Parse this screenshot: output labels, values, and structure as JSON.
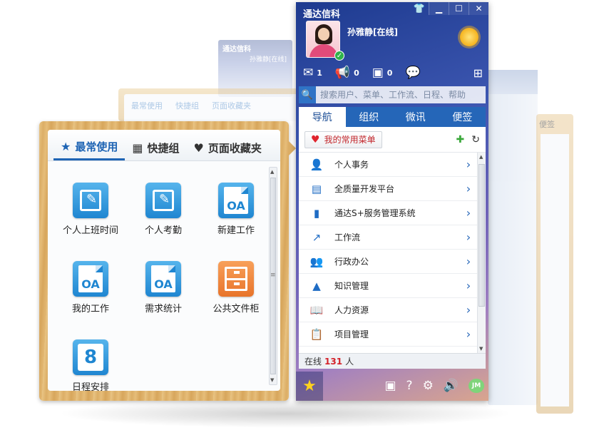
{
  "ghost": {
    "title": "通达信科",
    "name": "孙雅静[在线]",
    "tabs": [
      "最常使用",
      "快捷组",
      "页面收藏夹"
    ],
    "right_label": "便签"
  },
  "favorites": {
    "tabs": [
      {
        "label": "最常使用",
        "icon": "star-icon",
        "active": true
      },
      {
        "label": "快捷组",
        "icon": "grid-icon",
        "active": false
      },
      {
        "label": "页面收藏夹",
        "icon": "heart-icon",
        "active": false
      }
    ],
    "apps": [
      {
        "label": "个人上班时间",
        "icon": "edit-doc-icon",
        "color": "#2a8fd6"
      },
      {
        "label": "个人考勤",
        "icon": "edit-doc-icon",
        "color": "#2a8fd6"
      },
      {
        "label": "新建工作",
        "icon": "oa-doc-icon",
        "badge": "OA",
        "color": "#2a8fd6"
      },
      {
        "label": "我的工作",
        "icon": "oa-doc-icon",
        "badge": "OA",
        "color": "#2a8fd6"
      },
      {
        "label": "需求统计",
        "icon": "oa-doc-icon",
        "badge": "OA",
        "color": "#2a8fd6"
      },
      {
        "label": "公共文件柜",
        "icon": "cabinet-icon",
        "color": "#ec7d32"
      },
      {
        "label": "日程安排",
        "icon": "calendar-icon",
        "badge": "8",
        "color": "#2a8fd6"
      }
    ]
  },
  "client": {
    "title": "通达信科",
    "user": {
      "name": "孙雅静[在线]",
      "status": "online"
    },
    "notifications": [
      {
        "icon": "mail-icon",
        "count": "1"
      },
      {
        "icon": "megaphone-icon",
        "count": "0"
      },
      {
        "icon": "plus-grid-icon",
        "count": "0"
      },
      {
        "icon": "chat-icon",
        "count": ""
      }
    ],
    "search": {
      "placeholder": "搜索用户、菜单、工作流、日程、帮助"
    },
    "tabs": [
      {
        "label": "导航",
        "active": true
      },
      {
        "label": "组织",
        "active": false
      },
      {
        "label": "微讯",
        "active": false
      },
      {
        "label": "便签",
        "active": false
      }
    ],
    "menu_button": "我的常用菜单",
    "menu": [
      {
        "label": "个人事务",
        "icon": "person-icon"
      },
      {
        "label": "全质量开发平台",
        "icon": "screen-icon"
      },
      {
        "label": "通达S+服务管理系统",
        "icon": "document-icon"
      },
      {
        "label": "工作流",
        "icon": "share-icon"
      },
      {
        "label": "行政办公",
        "icon": "group-icon"
      },
      {
        "label": "知识管理",
        "icon": "archive-icon"
      },
      {
        "label": "人力资源",
        "icon": "book-user-icon"
      },
      {
        "label": "项目管理",
        "icon": "clipboard-icon"
      }
    ],
    "online": {
      "prefix": "在线",
      "count": "131",
      "suffix": "人"
    }
  },
  "colors": {
    "accent": "#2566b8",
    "brand_orange": "#ec7d32",
    "online_count": "#d4222a"
  }
}
